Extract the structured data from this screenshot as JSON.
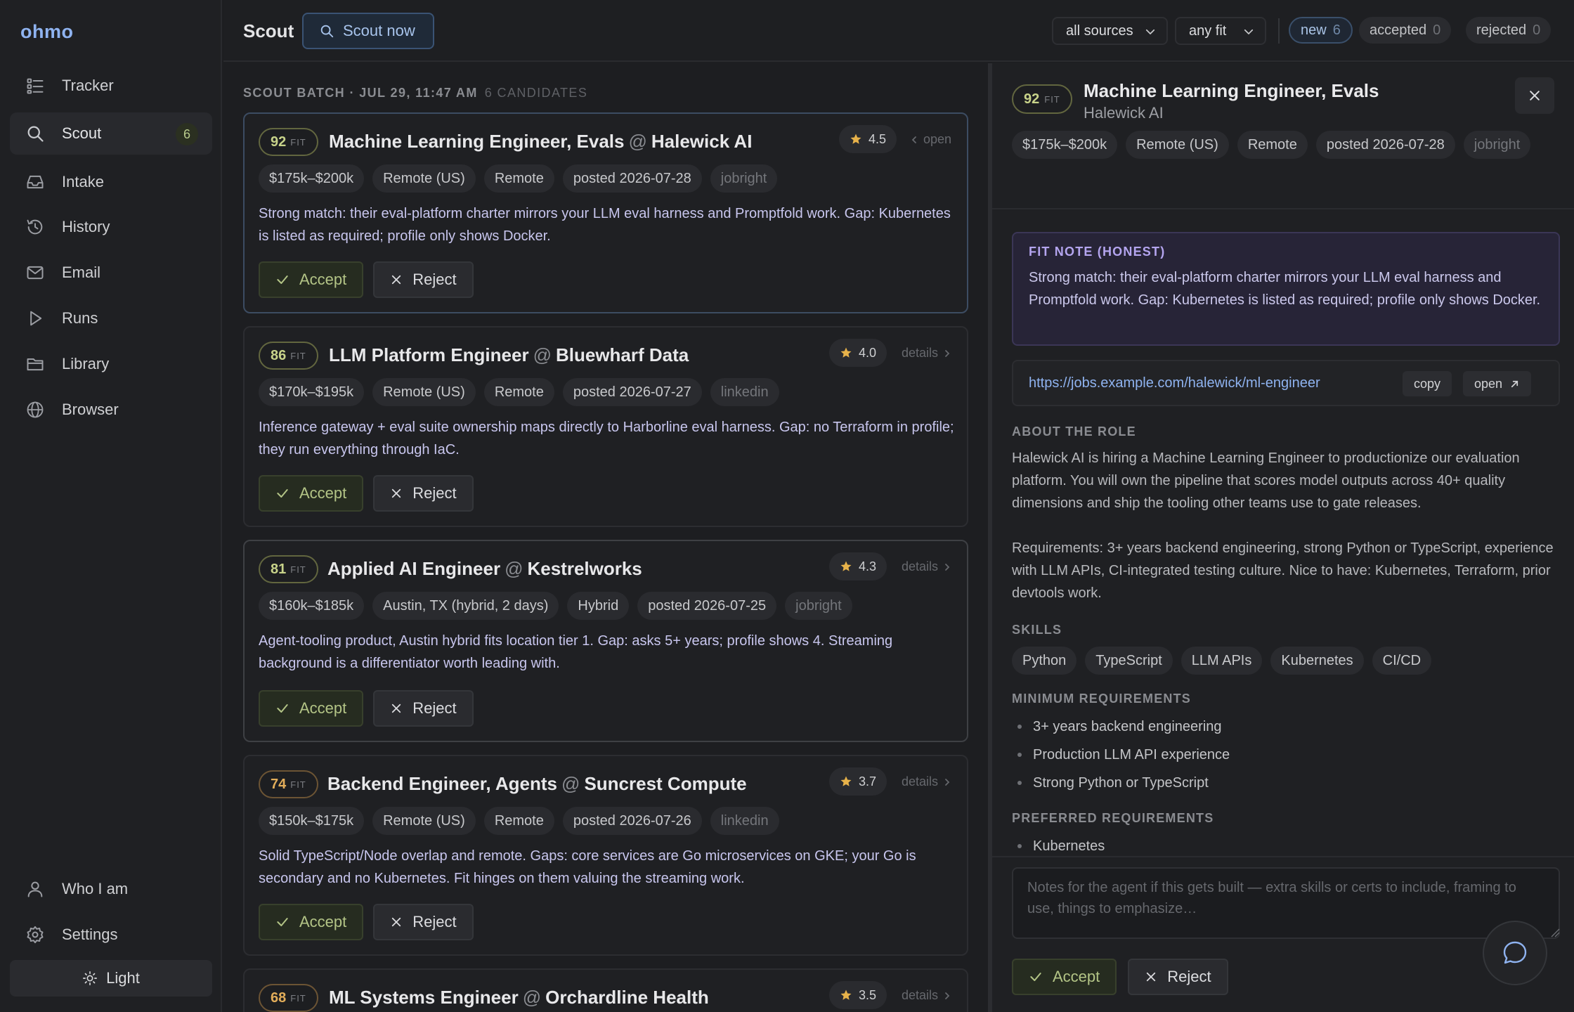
{
  "brand": "ohmo",
  "sidebar": {
    "items": [
      {
        "label": "Tracker",
        "icon": "tracker-icon"
      },
      {
        "label": "Scout",
        "icon": "search-icon",
        "count": "6",
        "active": true
      },
      {
        "label": "Intake",
        "icon": "inbox-icon"
      },
      {
        "label": "History",
        "icon": "history-icon"
      },
      {
        "label": "Email",
        "icon": "mail-icon"
      },
      {
        "label": "Runs",
        "icon": "play-icon"
      },
      {
        "label": "Library",
        "icon": "folder-icon"
      },
      {
        "label": "Browser",
        "icon": "globe-icon"
      }
    ],
    "bottom": [
      {
        "label": "Who I am",
        "icon": "user-icon"
      },
      {
        "label": "Settings",
        "icon": "gear-icon"
      }
    ],
    "theme_toggle": "Light"
  },
  "topbar": {
    "title": "Scout",
    "scout_now": "Scout now",
    "source_filter": "all sources",
    "fit_filter": "any fit",
    "status_pills": [
      {
        "label": "new",
        "count": "6"
      },
      {
        "label": "accepted",
        "count": "0"
      },
      {
        "label": "rejected",
        "count": "0"
      }
    ]
  },
  "batch": {
    "header": "SCOUT BATCH · JUL 29, 11:47 AM",
    "candidates": "6 CANDIDATES"
  },
  "fit_label": "FIT",
  "accept_label": "Accept",
  "reject_label": "Reject",
  "cards": [
    {
      "fit": "92",
      "title": "Machine Learning Engineer, Evals",
      "company": "Halewick AI",
      "rating": "4.5",
      "link": "open",
      "tags": [
        "$175k–$200k",
        "Remote (US)",
        "Remote",
        "posted 2026-07-28"
      ],
      "source": "jobright",
      "note": "Strong match: their eval-platform charter mirrors your LLM eval harness and Promptfold work. Gap: Kubernetes is listed as required; profile only shows Docker."
    },
    {
      "fit": "86",
      "title": "LLM Platform Engineer",
      "company": "Bluewharf Data",
      "rating": "4.0",
      "link": "details",
      "tags": [
        "$170k–$195k",
        "Remote (US)",
        "Remote",
        "posted 2026-07-27"
      ],
      "source": "linkedin",
      "note": "Inference gateway + eval suite ownership maps directly to Harborline eval harness. Gap: no Terraform in profile; they run everything through IaC."
    },
    {
      "fit": "81",
      "title": "Applied AI Engineer",
      "company": "Kestrelworks",
      "rating": "4.3",
      "link": "details",
      "tags": [
        "$160k–$185k",
        "Austin, TX (hybrid, 2 days)",
        "Hybrid",
        "posted 2026-07-25"
      ],
      "source": "jobright",
      "note": "Agent-tooling product, Austin hybrid fits location tier 1. Gap: asks 5+ years; profile shows 4. Streaming background is a differentiator worth leading with."
    },
    {
      "fit": "74",
      "title": "Backend Engineer, Agents",
      "company": "Suncrest Compute",
      "rating": "3.7",
      "link": "details",
      "tags": [
        "$150k–$175k",
        "Remote (US)",
        "Remote",
        "posted 2026-07-26"
      ],
      "source": "linkedin",
      "note": "Solid TypeScript/Node overlap and remote. Gaps: core services are Go microservices on GKE; your Go is secondary and no Kubernetes. Fit hinges on them valuing the streaming work."
    },
    {
      "fit": "68",
      "title": "ML Systems Engineer",
      "company": "Orchardline Health",
      "rating": "3.5",
      "link": "details",
      "tags": [],
      "source": "",
      "note": ""
    }
  ],
  "detail": {
    "fit": "92",
    "title": "Machine Learning Engineer, Evals",
    "company": "Halewick AI",
    "tags": [
      "$175k–$200k",
      "Remote (US)",
      "Remote",
      "posted 2026-07-28"
    ],
    "source": "jobright",
    "fit_note_heading": "FIT NOTE (HONEST)",
    "fit_note": "Strong match: their eval-platform charter mirrors your LLM eval harness and Promptfold work. Gap: Kubernetes is listed as required; profile only shows Docker.",
    "url": "https://jobs.example.com/halewick/ml-engineer",
    "copy_label": "copy",
    "open_label": "open",
    "about_heading": "ABOUT THE ROLE",
    "about_p1": "Halewick AI is hiring a Machine Learning Engineer to productionize our evaluation platform. You will own the pipeline that scores model outputs across 40+ quality dimensions and ship the tooling other teams use to gate releases.",
    "about_p2": "Requirements: 3+ years backend engineering, strong Python or TypeScript, experience with LLM APIs, CI-integrated testing culture. Nice to have: Kubernetes, Terraform, prior devtools work.",
    "skills_heading": "SKILLS",
    "skills": [
      "Python",
      "TypeScript",
      "LLM APIs",
      "Kubernetes",
      "CI/CD"
    ],
    "min_req_heading": "MINIMUM REQUIREMENTS",
    "min_req": [
      "3+ years backend engineering",
      "Production LLM API experience",
      "Strong Python or TypeScript"
    ],
    "pref_req_heading": "PREFERRED REQUIREMENTS",
    "pref_req": [
      "Kubernetes"
    ],
    "notes_placeholder": "Notes for the agent if this gets built — extra skills or certs to include, framing to use, things to emphasize…",
    "accept": "Accept",
    "reject": "Reject"
  },
  "colors": {
    "accent_blue": "#8fb3f0",
    "fit_green": "#c8d38a",
    "fit_orange": "#e2ad5a",
    "star": "#e7b24a",
    "fit_note_bg": "#272437"
  }
}
